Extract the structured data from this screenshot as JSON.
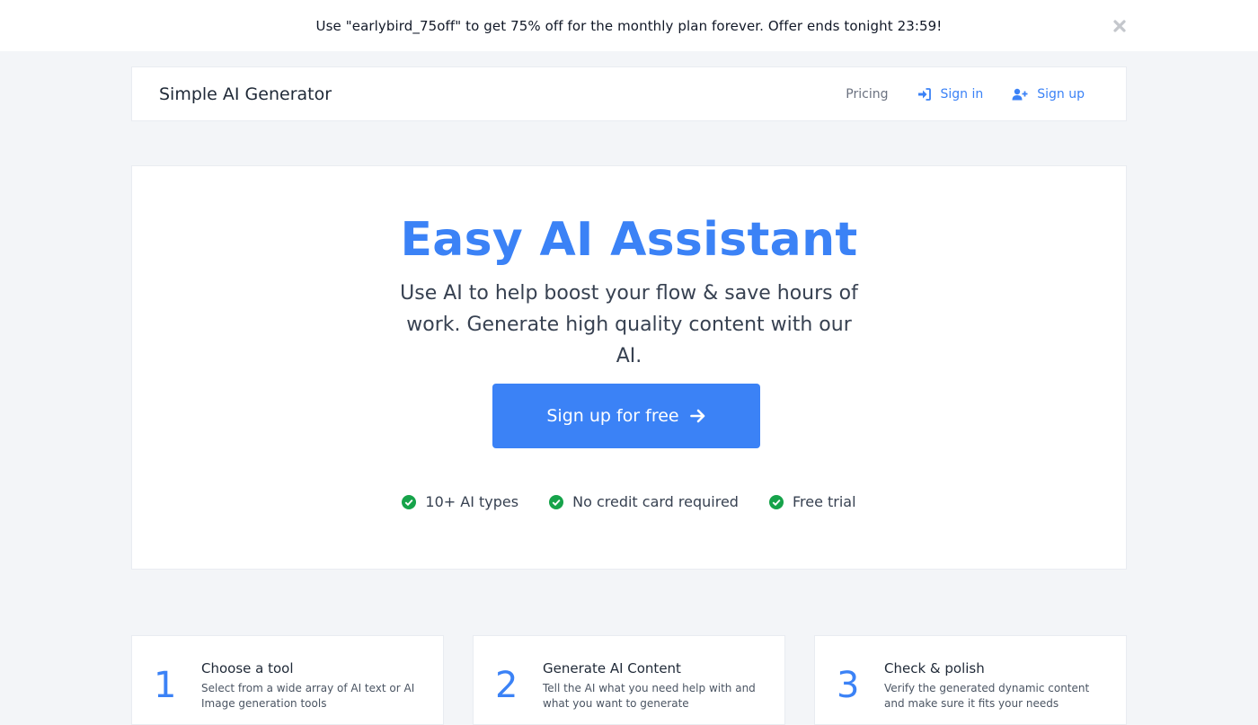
{
  "promo": {
    "text": "Use \"earlybird_75off\" to get 75% off for the monthly plan forever. Offer ends tonight 23:59!",
    "close_icon": "times-icon"
  },
  "navbar": {
    "brand": "Simple AI Generator",
    "pricing": "Pricing",
    "sign_in": "Sign in",
    "sign_in_icon": "sign-in-icon",
    "sign_up": "Sign up",
    "sign_up_icon": "user-plus-icon"
  },
  "hero": {
    "title": "Easy AI Assistant",
    "subtitle": "Use AI to help boost your flow & save hours of work. Generate high quality content with our AI.",
    "cta_label": "Sign up for free",
    "cta_icon": "arrow-right-icon",
    "features": [
      {
        "label": "10+ AI types",
        "icon": "check-circle-icon"
      },
      {
        "label": "No credit card required",
        "icon": "check-circle-icon"
      },
      {
        "label": "Free trial",
        "icon": "check-circle-icon"
      }
    ]
  },
  "steps": [
    {
      "number": "1",
      "title": "Choose a tool",
      "description": "Select from a wide array of AI text or AI Image generation tools"
    },
    {
      "number": "2",
      "title": "Generate AI Content",
      "description": "Tell the AI what you need help with and what you want to generate"
    },
    {
      "number": "3",
      "title": "Check & polish",
      "description": "Verify the generated dynamic content and make sure it fits your needs"
    }
  ],
  "colors": {
    "accent": "#3b82f6",
    "check": "#16a34a",
    "background": "#f3f5f8"
  }
}
